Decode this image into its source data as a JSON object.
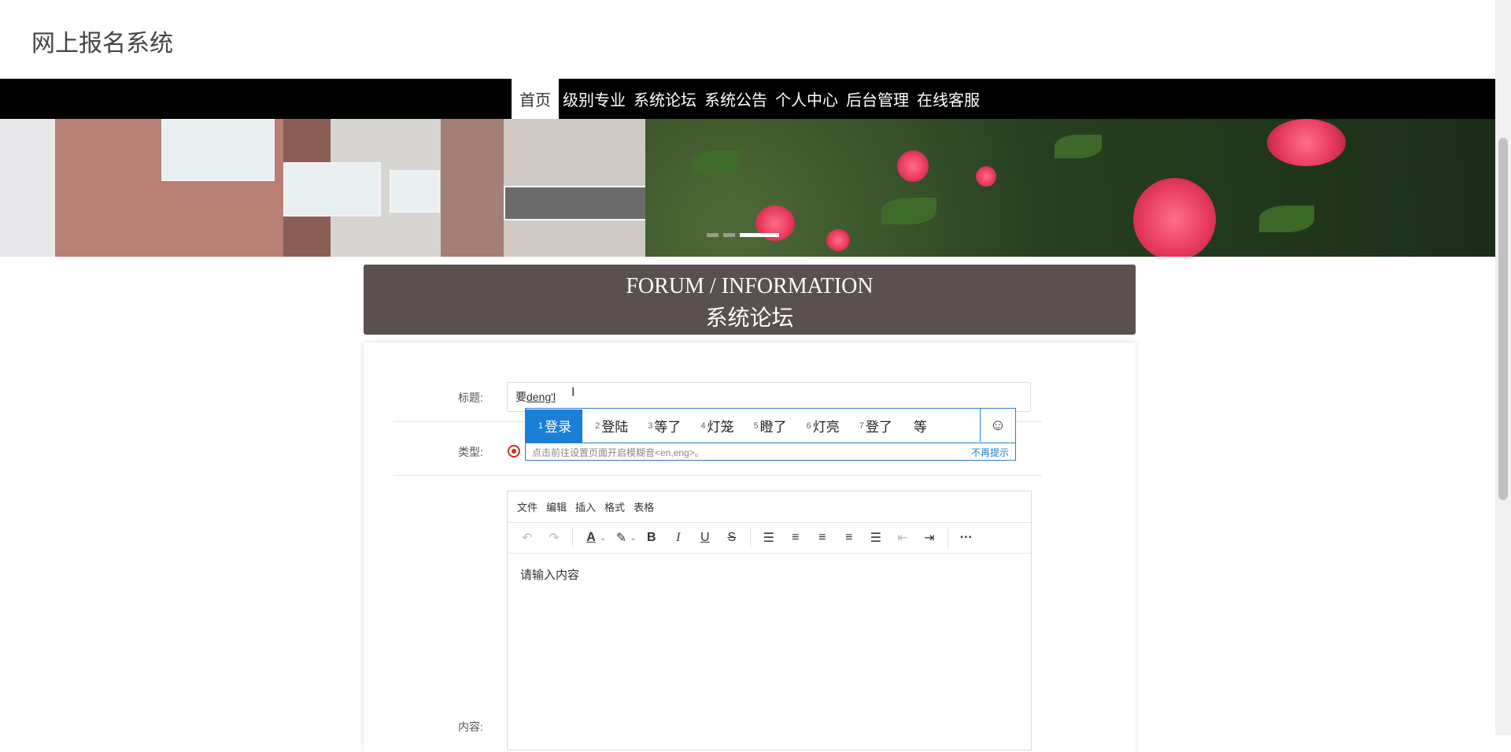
{
  "header": {
    "site_title": "网上报名系统"
  },
  "nav": {
    "items": [
      "首页",
      "级别专业",
      "系统论坛",
      "系统公告",
      "个人中心",
      "后台管理",
      "在线客服"
    ]
  },
  "forum": {
    "heading_en": "FORUM / INFORMATION",
    "heading_cn": "系统论坛"
  },
  "form": {
    "title_label": "标题:",
    "title_value_prefix": "要",
    "title_value_composing": "deng'l",
    "type_label": "类型:",
    "content_label": "内容:"
  },
  "ime": {
    "candidates": [
      {
        "num": "1",
        "text": "登录"
      },
      {
        "num": "2",
        "text": "登陆"
      },
      {
        "num": "3",
        "text": "等了"
      },
      {
        "num": "4",
        "text": "灯笼"
      },
      {
        "num": "5",
        "text": "瞪了"
      },
      {
        "num": "6",
        "text": "灯亮"
      },
      {
        "num": "7",
        "text": "登了"
      },
      {
        "num": "",
        "text": "等"
      }
    ],
    "tip": "点击前往设置页面开启模糊音<en,eng>。",
    "dismiss": "不再提示"
  },
  "editor": {
    "menus": [
      "文件",
      "编辑",
      "插入",
      "格式",
      "表格"
    ],
    "placeholder": "请输入内容"
  }
}
